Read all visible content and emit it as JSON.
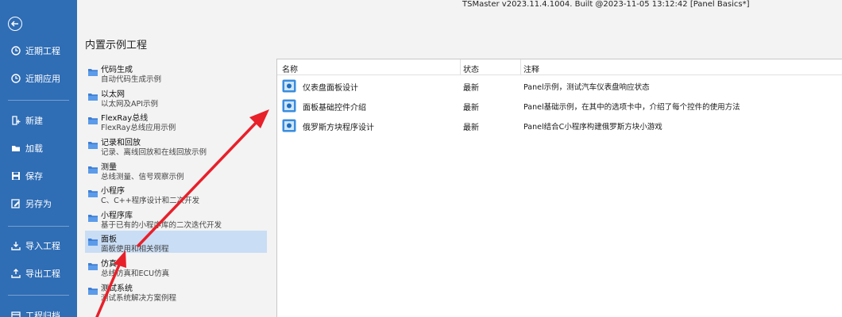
{
  "window": {
    "title": "TSMaster v2023.11.4.1004. Built @2023-11-05 13:12:42 [Panel Basics*]"
  },
  "sidebar": {
    "items": [
      {
        "label": "近期工程",
        "icon": "clock-icon"
      },
      {
        "label": "近期应用",
        "icon": "clock-icon"
      },
      {
        "label": "新建",
        "icon": "new-file-icon"
      },
      {
        "label": "加载",
        "icon": "open-folder-icon"
      },
      {
        "label": "保存",
        "icon": "save-icon"
      },
      {
        "label": "另存为",
        "icon": "save-as-icon"
      },
      {
        "label": "导入工程",
        "icon": "import-icon"
      },
      {
        "label": "导出工程",
        "icon": "export-icon"
      },
      {
        "label": "工程归档",
        "icon": "archive-icon"
      }
    ]
  },
  "main": {
    "section_title": "内置示例工程",
    "categories": [
      {
        "name": "代码生成",
        "desc": "自动代码生成示例"
      },
      {
        "name": "以太网",
        "desc": "以太网及API示例"
      },
      {
        "name": "FlexRay总线",
        "desc": "FlexRay总线应用示例"
      },
      {
        "name": "记录和回放",
        "desc": "记录、离线回放和在线回放示例"
      },
      {
        "name": "测量",
        "desc": "总线测量、信号观察示例"
      },
      {
        "name": "小程序",
        "desc": "C、C++程序设计和二次开发"
      },
      {
        "name": "小程序库",
        "desc": "基于已有的小程序库的二次迭代开发"
      },
      {
        "name": "面板",
        "desc": "面板使用和相关例程",
        "selected": true
      },
      {
        "name": "仿真",
        "desc": "总线仿真和ECU仿真"
      },
      {
        "name": "测试系统",
        "desc": "测试系统解决方案例程"
      }
    ],
    "table": {
      "columns": [
        "名称",
        "状态",
        "注释"
      ],
      "rows": [
        {
          "name": "仪表盘面板设计",
          "status": "最新",
          "note": "Panel示例，测试汽车仪表盘响应状态"
        },
        {
          "name": "面板基础控件介绍",
          "status": "最新",
          "note": "Panel基础示例，在其中的选项卡中，介绍了每个控件的使用方法"
        },
        {
          "name": "俄罗斯方块程序设计",
          "status": "最新",
          "note": "Panel结合C小程序构建俄罗斯方块小游戏"
        }
      ]
    }
  },
  "colors": {
    "sidebar": "#2f6db5",
    "selection": "#c9ddf5",
    "arrow": "#e8202a"
  }
}
